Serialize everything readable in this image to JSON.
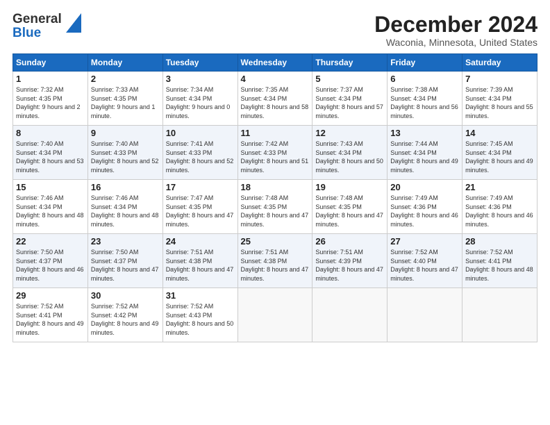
{
  "logo": {
    "line1": "General",
    "line2": "Blue"
  },
  "title": "December 2024",
  "subtitle": "Waconia, Minnesota, United States",
  "days_of_week": [
    "Sunday",
    "Monday",
    "Tuesday",
    "Wednesday",
    "Thursday",
    "Friday",
    "Saturday"
  ],
  "weeks": [
    [
      {
        "day": "1",
        "sunrise": "7:32 AM",
        "sunset": "4:35 PM",
        "daylight": "9 hours and 2 minutes."
      },
      {
        "day": "2",
        "sunrise": "7:33 AM",
        "sunset": "4:35 PM",
        "daylight": "9 hours and 1 minute."
      },
      {
        "day": "3",
        "sunrise": "7:34 AM",
        "sunset": "4:34 PM",
        "daylight": "9 hours and 0 minutes."
      },
      {
        "day": "4",
        "sunrise": "7:35 AM",
        "sunset": "4:34 PM",
        "daylight": "8 hours and 58 minutes."
      },
      {
        "day": "5",
        "sunrise": "7:37 AM",
        "sunset": "4:34 PM",
        "daylight": "8 hours and 57 minutes."
      },
      {
        "day": "6",
        "sunrise": "7:38 AM",
        "sunset": "4:34 PM",
        "daylight": "8 hours and 56 minutes."
      },
      {
        "day": "7",
        "sunrise": "7:39 AM",
        "sunset": "4:34 PM",
        "daylight": "8 hours and 55 minutes."
      }
    ],
    [
      {
        "day": "8",
        "sunrise": "7:40 AM",
        "sunset": "4:34 PM",
        "daylight": "8 hours and 53 minutes."
      },
      {
        "day": "9",
        "sunrise": "7:40 AM",
        "sunset": "4:33 PM",
        "daylight": "8 hours and 52 minutes."
      },
      {
        "day": "10",
        "sunrise": "7:41 AM",
        "sunset": "4:33 PM",
        "daylight": "8 hours and 52 minutes."
      },
      {
        "day": "11",
        "sunrise": "7:42 AM",
        "sunset": "4:33 PM",
        "daylight": "8 hours and 51 minutes."
      },
      {
        "day": "12",
        "sunrise": "7:43 AM",
        "sunset": "4:34 PM",
        "daylight": "8 hours and 50 minutes."
      },
      {
        "day": "13",
        "sunrise": "7:44 AM",
        "sunset": "4:34 PM",
        "daylight": "8 hours and 49 minutes."
      },
      {
        "day": "14",
        "sunrise": "7:45 AM",
        "sunset": "4:34 PM",
        "daylight": "8 hours and 49 minutes."
      }
    ],
    [
      {
        "day": "15",
        "sunrise": "7:46 AM",
        "sunset": "4:34 PM",
        "daylight": "8 hours and 48 minutes."
      },
      {
        "day": "16",
        "sunrise": "7:46 AM",
        "sunset": "4:34 PM",
        "daylight": "8 hours and 48 minutes."
      },
      {
        "day": "17",
        "sunrise": "7:47 AM",
        "sunset": "4:35 PM",
        "daylight": "8 hours and 47 minutes."
      },
      {
        "day": "18",
        "sunrise": "7:48 AM",
        "sunset": "4:35 PM",
        "daylight": "8 hours and 47 minutes."
      },
      {
        "day": "19",
        "sunrise": "7:48 AM",
        "sunset": "4:35 PM",
        "daylight": "8 hours and 47 minutes."
      },
      {
        "day": "20",
        "sunrise": "7:49 AM",
        "sunset": "4:36 PM",
        "daylight": "8 hours and 46 minutes."
      },
      {
        "day": "21",
        "sunrise": "7:49 AM",
        "sunset": "4:36 PM",
        "daylight": "8 hours and 46 minutes."
      }
    ],
    [
      {
        "day": "22",
        "sunrise": "7:50 AM",
        "sunset": "4:37 PM",
        "daylight": "8 hours and 46 minutes."
      },
      {
        "day": "23",
        "sunrise": "7:50 AM",
        "sunset": "4:37 PM",
        "daylight": "8 hours and 47 minutes."
      },
      {
        "day": "24",
        "sunrise": "7:51 AM",
        "sunset": "4:38 PM",
        "daylight": "8 hours and 47 minutes."
      },
      {
        "day": "25",
        "sunrise": "7:51 AM",
        "sunset": "4:38 PM",
        "daylight": "8 hours and 47 minutes."
      },
      {
        "day": "26",
        "sunrise": "7:51 AM",
        "sunset": "4:39 PM",
        "daylight": "8 hours and 47 minutes."
      },
      {
        "day": "27",
        "sunrise": "7:52 AM",
        "sunset": "4:40 PM",
        "daylight": "8 hours and 47 minutes."
      },
      {
        "day": "28",
        "sunrise": "7:52 AM",
        "sunset": "4:41 PM",
        "daylight": "8 hours and 48 minutes."
      }
    ],
    [
      {
        "day": "29",
        "sunrise": "7:52 AM",
        "sunset": "4:41 PM",
        "daylight": "8 hours and 49 minutes."
      },
      {
        "day": "30",
        "sunrise": "7:52 AM",
        "sunset": "4:42 PM",
        "daylight": "8 hours and 49 minutes."
      },
      {
        "day": "31",
        "sunrise": "7:52 AM",
        "sunset": "4:43 PM",
        "daylight": "8 hours and 50 minutes."
      },
      null,
      null,
      null,
      null
    ]
  ],
  "labels": {
    "sunrise": "Sunrise:",
    "sunset": "Sunset:",
    "daylight": "Daylight:"
  }
}
